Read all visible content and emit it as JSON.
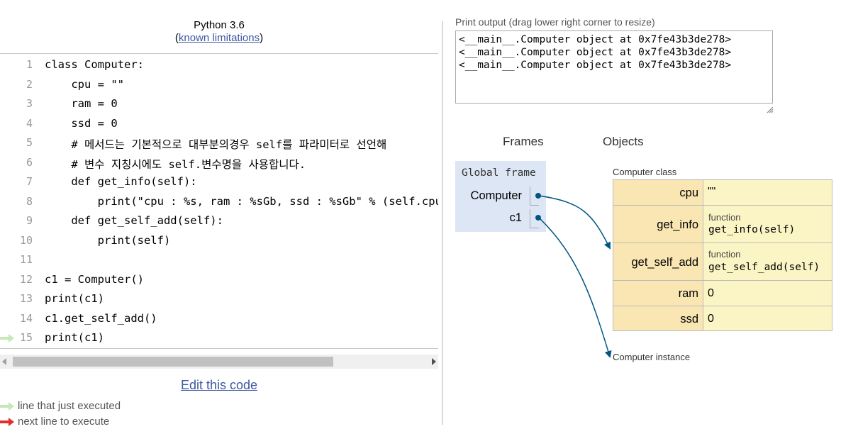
{
  "header": {
    "language": "Python 3.6",
    "limitations_link": "known limitations",
    "paren_open": "(",
    "paren_close": ")"
  },
  "code": {
    "lines": [
      {
        "no": "1",
        "text": "class Computer:"
      },
      {
        "no": "2",
        "text": "    cpu = \"\""
      },
      {
        "no": "3",
        "text": "    ram = 0"
      },
      {
        "no": "4",
        "text": "    ssd = 0"
      },
      {
        "no": "5",
        "text": "    # 메서드는 기본적으로 대부분의경우 self를 파라미터로 선언해"
      },
      {
        "no": "6",
        "text": "    # 변수 지칭시에도 self.변수명을 사용합니다."
      },
      {
        "no": "7",
        "text": "    def get_info(self):"
      },
      {
        "no": "8",
        "text": "        print(\"cpu : %s, ram : %sGb, ssd : %sGb\" % (self.cpu,"
      },
      {
        "no": "9",
        "text": "    def get_self_add(self):"
      },
      {
        "no": "10",
        "text": "        print(self)"
      },
      {
        "no": "11",
        "text": ""
      },
      {
        "no": "12",
        "text": "c1 = Computer()"
      },
      {
        "no": "13",
        "text": "print(c1)"
      },
      {
        "no": "14",
        "text": "c1.get_self_add()"
      },
      {
        "no": "15",
        "text": "print(c1)"
      }
    ],
    "current_line": "15"
  },
  "edit_link": "Edit this code",
  "legend": {
    "just_executed": "line that just executed",
    "next_line": "next line to execute"
  },
  "print_output": {
    "label": "Print output (drag lower right corner to resize)",
    "lines": [
      "<__main__.Computer object at 0x7fe43b3de278>",
      "<__main__.Computer object at 0x7fe43b3de278>",
      "<__main__.Computer object at 0x7fe43b3de278>"
    ]
  },
  "frames": {
    "header": "Frames",
    "global_label": "Global frame",
    "vars": [
      {
        "name": "Computer"
      },
      {
        "name": "c1"
      }
    ]
  },
  "objects": {
    "header": "Objects",
    "class_label": "Computer class",
    "class_rows": [
      {
        "key": "cpu",
        "value": "\"\""
      },
      {
        "key": "get_info",
        "tag": "function",
        "value": "get_info(self)"
      },
      {
        "key": "get_self_add",
        "tag": "function",
        "value": "get_self_add(self)"
      },
      {
        "key": "ram",
        "value": "0"
      },
      {
        "key": "ssd",
        "value": "0"
      }
    ],
    "instance_label": "Computer instance"
  },
  "colors": {
    "link": "#3D58A2",
    "frame_bg": "#dde6f4",
    "class_key_bg": "#f9e6b3",
    "class_value_bg": "#fbf5c5",
    "pointer": "#005583",
    "arrow_executed": "#c5e8b8",
    "arrow_next": "#e0302a"
  }
}
